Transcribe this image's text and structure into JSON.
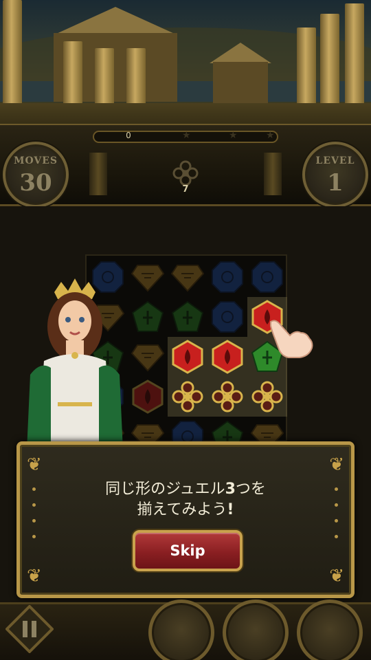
{
  "hud": {
    "score": "0",
    "moves_label": "MOVES",
    "moves_value": "30",
    "level_label": "LEVEL",
    "level_value": "1",
    "goal_count": "7",
    "goal_icon": "gold-amulet-icon"
  },
  "board": {
    "rows": 5,
    "cols": 5,
    "gems": [
      [
        "blue",
        "gold",
        "gold",
        "blue",
        "blue"
      ],
      [
        "gold",
        "green",
        "green",
        "blue",
        "red"
      ],
      [
        "green",
        "gold",
        "red",
        "red",
        "green"
      ],
      [
        "blue",
        "red",
        "amulet",
        "amulet",
        "amulet"
      ],
      [
        "gold",
        "gold",
        "blue",
        "green",
        "gold"
      ]
    ],
    "highlighted": [
      [
        1,
        4
      ],
      [
        2,
        2
      ],
      [
        2,
        3
      ],
      [
        2,
        4
      ],
      [
        3,
        2
      ],
      [
        3,
        3
      ],
      [
        3,
        4
      ]
    ]
  },
  "dialog": {
    "line1_a": "同じ形のジュエル",
    "line1_b": "3",
    "line1_c": "つを",
    "line2_a": "揃えてみよう",
    "line2_b": "!",
    "skip_label": "Skip"
  },
  "colors": {
    "red": "#c8201e",
    "green": "#2e8a2a",
    "blue": "#1f4fa8",
    "gold": "#b8892e",
    "frame": "#b89748"
  }
}
